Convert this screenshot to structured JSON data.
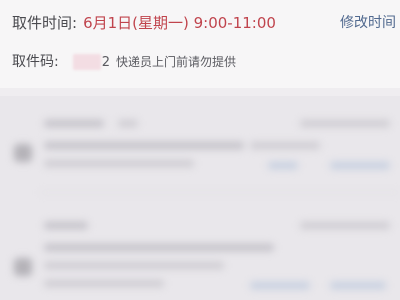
{
  "pickup": {
    "time_label": "取件时间:",
    "time_value": "6月1日(星期一) 9:00-11:00",
    "modify_label": "修改时间",
    "code_label": "取件码:",
    "code_visible_tail": "2",
    "code_hint": "快递员上门前请勿提供"
  },
  "colors": {
    "time_value": "#c0444d",
    "modify_link": "#51698f",
    "background": "#efedf0"
  }
}
